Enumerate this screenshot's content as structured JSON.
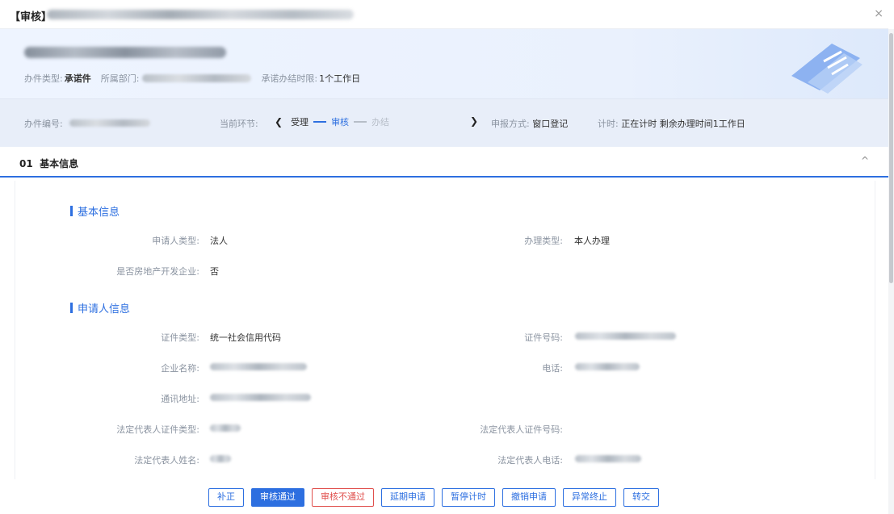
{
  "window": {
    "title_prefix": "【审核】",
    "close_glyph": "×"
  },
  "header": {
    "type_label": "办件类型:",
    "type_value": "承诺件",
    "dept_label": "所属部门:",
    "deadline_label": "承诺办结时限:",
    "deadline_value": "1个工作日"
  },
  "progress": {
    "number_label": "办件编号:",
    "current_label": "当前环节:",
    "prev_arrow": "❮",
    "next_arrow": "❯",
    "steps": [
      "受理",
      "审核",
      "办结"
    ],
    "apply_label": "申报方式:",
    "apply_value": "窗口登记",
    "timer_label": "计时:",
    "timer_value": "正在计时 剩余办理时间1工作日"
  },
  "section": {
    "number": "01",
    "title": "基本信息",
    "collapse_glyph": "^"
  },
  "basic": {
    "title": "基本信息",
    "applicant_type_label": "申请人类型:",
    "applicant_type_value": "法人",
    "handle_type_label": "办理类型:",
    "handle_type_value": "本人办理",
    "realestate_label": "是否房地产开发企业:",
    "realestate_value": "否"
  },
  "applicant": {
    "title": "申请人信息",
    "cert_type_label": "证件类型:",
    "cert_type_value": "统一社会信用代码",
    "cert_no_label": "证件号码:",
    "company_label": "企业名称:",
    "phone_label": "电话:",
    "address_label": "通讯地址:",
    "legal_cert_type_label": "法定代表人证件类型:",
    "legal_cert_no_label": "法定代表人证件号码:",
    "legal_name_label": "法定代表人姓名:",
    "legal_phone_label": "法定代表人电话:"
  },
  "footer": {
    "buttons": [
      "补正",
      "审核通过",
      "审核不通过",
      "延期申请",
      "暂停计时",
      "撤销申请",
      "异常终止",
      "转交"
    ]
  },
  "colors": {
    "accent": "#2d6fe0",
    "danger": "#e0504d",
    "header_bg": "#eaf1fd"
  }
}
